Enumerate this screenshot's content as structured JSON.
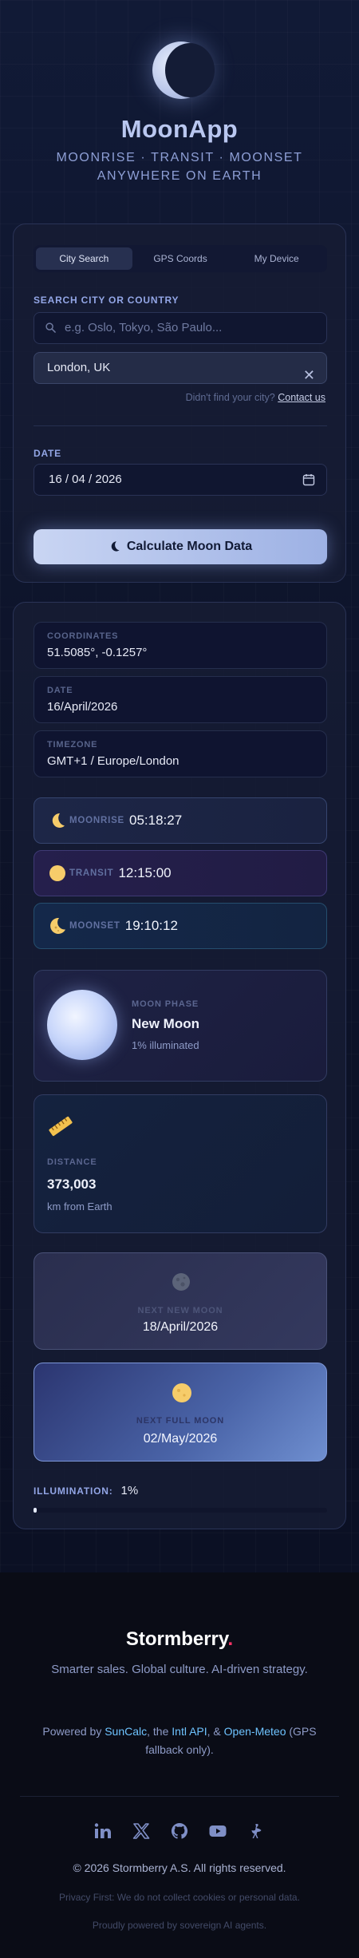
{
  "header": {
    "title": "MoonApp",
    "subtitle_line1": "MOONRISE · TRANSIT · MOONSET",
    "subtitle_line2": "ANYWHERE ON EARTH"
  },
  "form": {
    "tabs": [
      {
        "label": "City Search",
        "active": true
      },
      {
        "label": "GPS Coords",
        "active": false
      },
      {
        "label": "My Device",
        "active": false
      }
    ],
    "search_label": "SEARCH CITY OR COUNTRY",
    "search_placeholder": "e.g. Oslo, Tokyo, São Paulo...",
    "selected_city": "London, UK",
    "help_text": "Didn't find your city?",
    "help_link": "Contact us",
    "date_label": "DATE",
    "date_value": "16 / 04 / 2026",
    "calculate_label": "Calculate Moon Data"
  },
  "results": {
    "coordinates_label": "COORDINATES",
    "coordinates_value": "51.5085°, -0.1257°",
    "date_label": "DATE",
    "date_value": "16/April/2026",
    "timezone_label": "TIMEZONE",
    "timezone_value": "GMT+1 / Europe/London",
    "moonrise_label": "MOONRISE",
    "moonrise_time": "05:18:27",
    "transit_label": "TRANSIT",
    "transit_time": "12:15:00",
    "moonset_label": "MOONSET",
    "moonset_time": "19:10:12",
    "phase_label": "MOON PHASE",
    "phase_name": "New Moon",
    "phase_illum": "1% illuminated",
    "distance_label": "DISTANCE",
    "distance_value": "373,003",
    "distance_unit": "km from Earth",
    "next_new_label": "NEXT NEW MOON",
    "next_new_date": "18/April/2026",
    "next_full_label": "NEXT FULL MOON",
    "next_full_date": "02/May/2026",
    "illumination_label": "ILLUMINATION:",
    "illumination_value": "1%",
    "illumination_fraction": 0.01
  },
  "footer": {
    "brand": "Stormberry",
    "brand_dot": ".",
    "tagline": "Smarter sales. Global culture. AI-driven strategy.",
    "powered_prefix": "Powered by ",
    "suncalc": "SunCalc",
    "sep1": ", the ",
    "intl": "Intl API",
    "sep2": ", & ",
    "openmeteo": "Open-Meteo",
    "powered_suffix": " (GPS fallback only).",
    "copyright": "© 2026 Stormberry A.S. All rights reserved.",
    "privacy": "Privacy First: We do not collect cookies or personal data.",
    "powered_ai": "Proudly powered by sovereign AI agents."
  },
  "colors": {
    "accent": "#93a6e6",
    "link": "#6ec3ff",
    "brand_dot": "#ff3366",
    "moon_yellow": "#f6cc6a"
  }
}
